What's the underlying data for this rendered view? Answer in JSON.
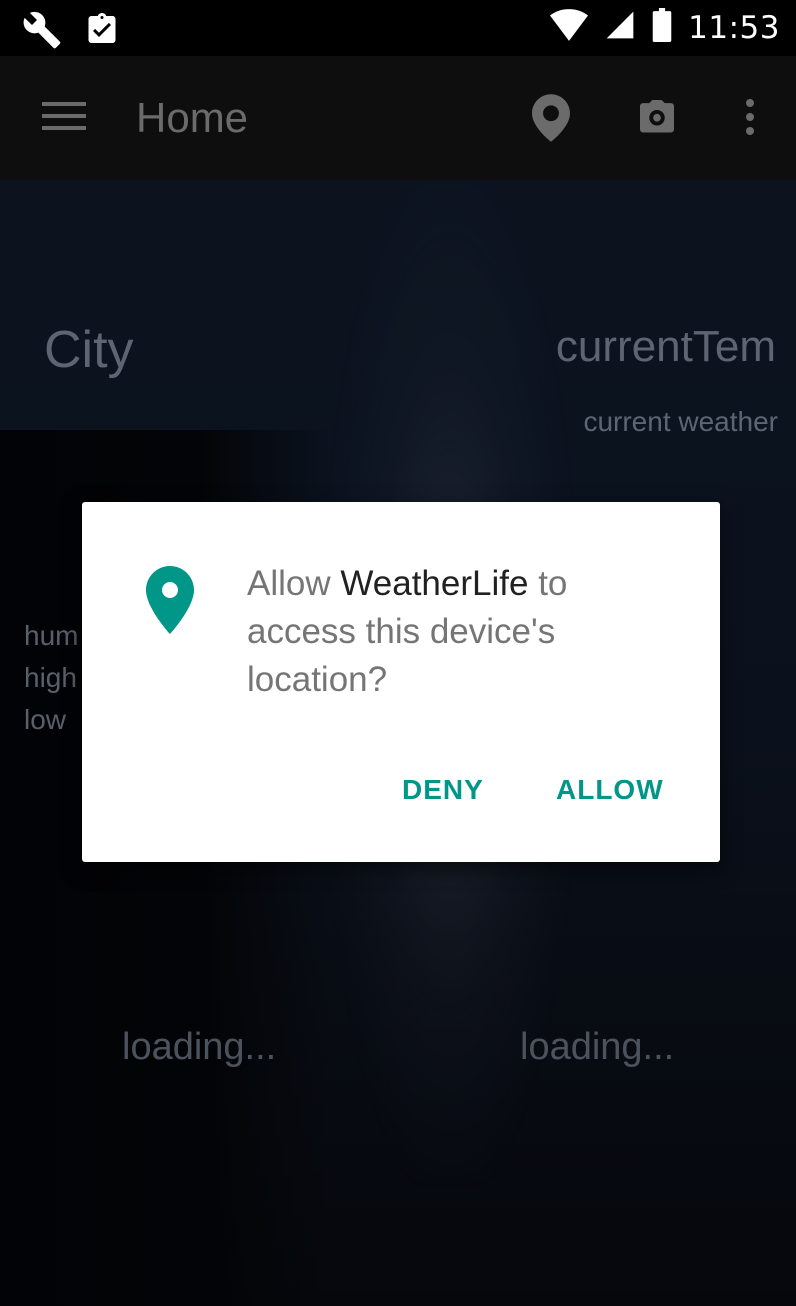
{
  "status_bar": {
    "time": "11:53",
    "icons": [
      "wrench-icon",
      "clipboard-check-icon",
      "wifi-icon",
      "signal-icon",
      "battery-icon"
    ]
  },
  "app_bar": {
    "title": "Home",
    "actions": [
      "location-pin-icon",
      "camera-icon",
      "more-vert-icon"
    ]
  },
  "weather": {
    "city": "City",
    "current_temp": "currentTem",
    "current_weather": "current weather",
    "stats": [
      "hum",
      "high",
      "low"
    ],
    "loading_left": "loading...",
    "loading_right": "loading..."
  },
  "permission_dialog": {
    "text_prefix": "Allow",
    "app_name": "WeatherLife",
    "text_suffix": "to access this device's location?",
    "deny_label": "DENY",
    "allow_label": "ALLOW",
    "accent_color": "#009688"
  }
}
